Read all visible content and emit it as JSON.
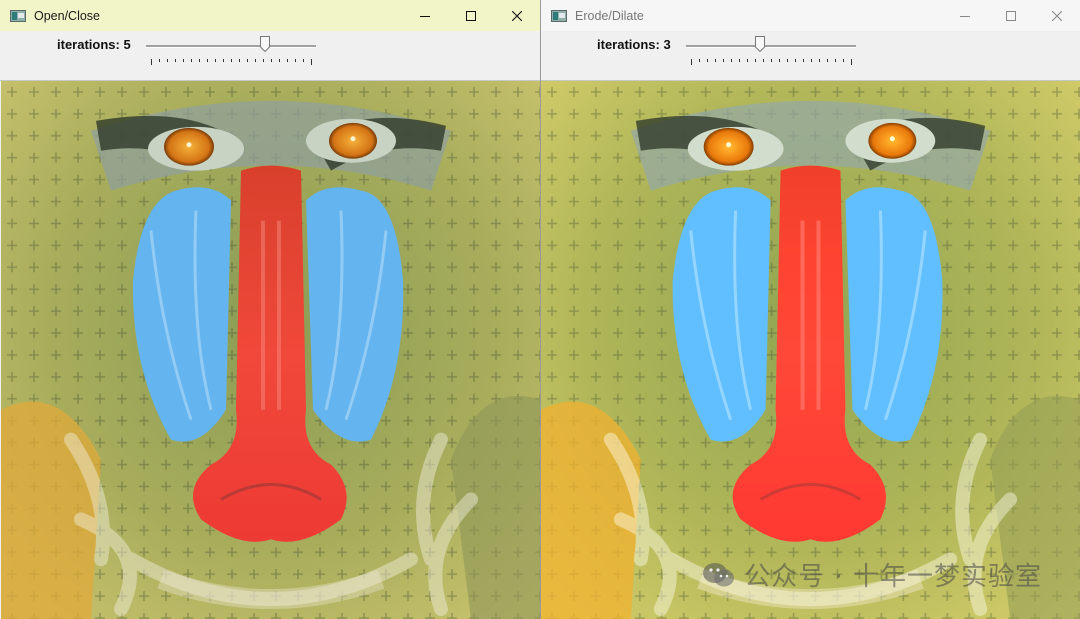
{
  "windows": [
    {
      "id": "open-close",
      "title": "Open/Close",
      "trackbar": {
        "label": "iterations: 5",
        "value": 5,
        "max": 7
      },
      "image": {
        "subject": "mandrill"
      }
    },
    {
      "id": "erode-dilate",
      "title": "Erode/Dilate",
      "trackbar": {
        "label": "iterations: 3",
        "value": 3,
        "max": 7
      },
      "image": {
        "subject": "mandrill"
      }
    }
  ],
  "watermark": {
    "text": "公众号 · 十年一梦实验室"
  },
  "colors": {
    "active_titlebar": "#f2f5c8",
    "inactive_titlebar": "#f6f6f6"
  },
  "icons": [
    "app-icon",
    "minimize-icon",
    "maximize-icon",
    "close-icon",
    "wechat-icon"
  ]
}
